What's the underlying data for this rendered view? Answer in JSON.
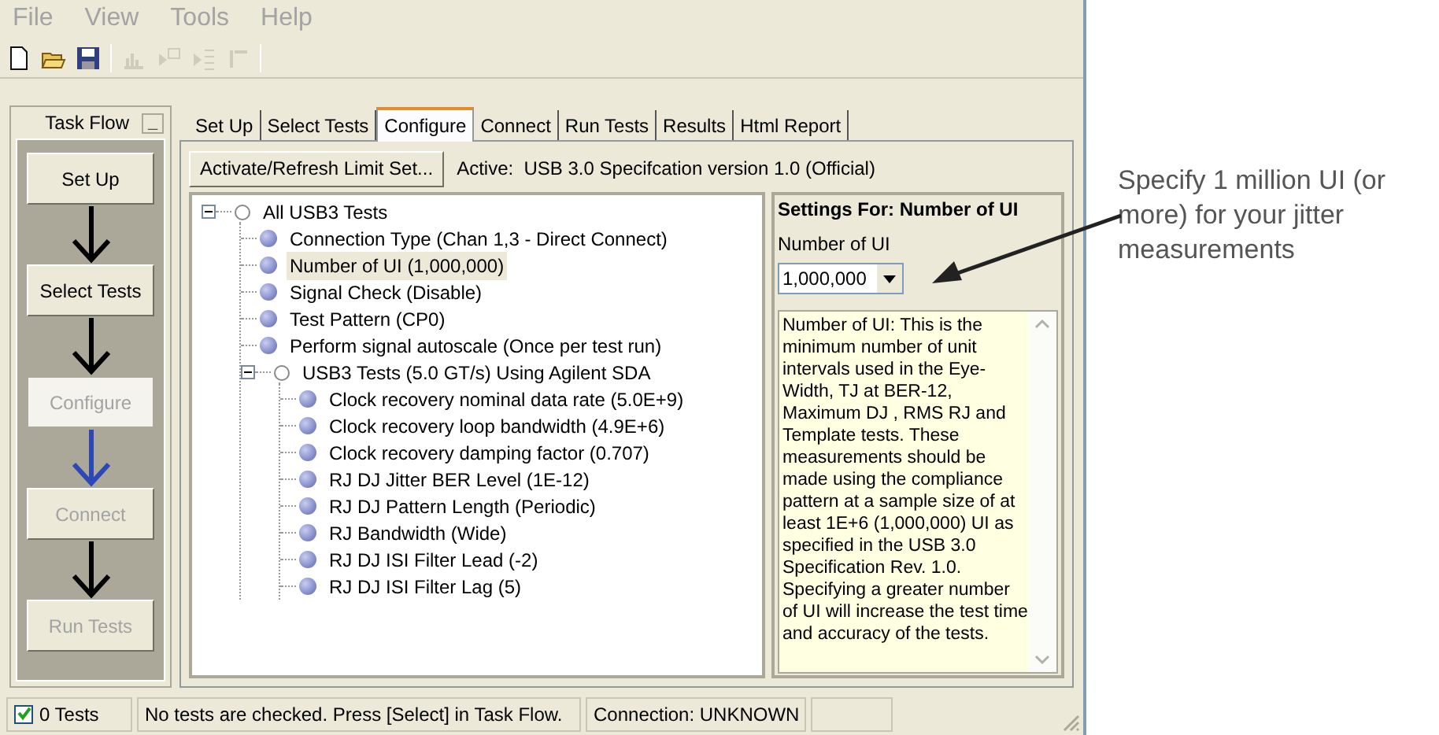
{
  "menu": [
    "File",
    "View",
    "Tools",
    "Help"
  ],
  "toolbar": [
    {
      "kind": "new",
      "disabled": false
    },
    {
      "kind": "open",
      "disabled": false
    },
    {
      "kind": "save",
      "disabled": false
    },
    {
      "kind": "sep"
    },
    {
      "kind": "chart",
      "disabled": true
    },
    {
      "kind": "run",
      "disabled": true
    },
    {
      "kind": "list",
      "disabled": true
    },
    {
      "kind": "bar",
      "disabled": true
    },
    {
      "kind": "sep"
    }
  ],
  "task_flow": {
    "title": "Task Flow",
    "collapse": "_",
    "steps": [
      {
        "label": "Set Up",
        "disabled": false,
        "current": false
      },
      {
        "label": "Select Tests",
        "disabled": false,
        "current": false
      },
      {
        "label": "Configure",
        "disabled": true,
        "current": true
      },
      {
        "label": "Connect",
        "disabled": true,
        "current": false
      },
      {
        "label": "Run Tests",
        "disabled": true,
        "current": false
      }
    ],
    "arrows": [
      {
        "color": "#000000"
      },
      {
        "color": "#000000"
      },
      {
        "color": "#2b47b8"
      },
      {
        "color": "#000000"
      }
    ]
  },
  "tabs": [
    {
      "label": "Set Up",
      "selected": false
    },
    {
      "label": "Select Tests",
      "selected": false
    },
    {
      "label": "Configure",
      "selected": true
    },
    {
      "label": "Connect",
      "selected": false
    },
    {
      "label": "Run Tests",
      "selected": false
    },
    {
      "label": "Results",
      "selected": false
    },
    {
      "label": "Html Report",
      "selected": false
    }
  ],
  "limit_button": "Activate/Refresh Limit Set...",
  "active_text": "Active:  USB 3.0 Specifcation version 1.0 (Official)",
  "tree": [
    {
      "kind": "group",
      "label": "All USB3 Tests",
      "expanded": true,
      "selected": false,
      "children": [
        {
          "kind": "leaf",
          "label": "Connection Type (Chan 1,3 - Direct Connect)",
          "selected": false
        },
        {
          "kind": "leaf",
          "label": "Number of UI (1,000,000)",
          "selected": true
        },
        {
          "kind": "leaf",
          "label": "Signal Check (Disable)",
          "selected": false
        },
        {
          "kind": "leaf",
          "label": "Test Pattern (CP0)",
          "selected": false
        },
        {
          "kind": "leaf",
          "label": "Perform signal autoscale (Once per test run)",
          "selected": false
        },
        {
          "kind": "group",
          "label": "USB3 Tests (5.0 GT/s) Using Agilent SDA",
          "expanded": true,
          "selected": false,
          "children": [
            {
              "kind": "leaf",
              "label": "Clock recovery nominal data rate (5.0E+9)",
              "selected": false
            },
            {
              "kind": "leaf",
              "label": "Clock recovery loop bandwidth (4.9E+6)",
              "selected": false
            },
            {
              "kind": "leaf",
              "label": "Clock recovery damping factor (0.707)",
              "selected": false
            },
            {
              "kind": "leaf",
              "label": "RJ DJ Jitter BER Level (1E-12)",
              "selected": false
            },
            {
              "kind": "leaf",
              "label": "RJ DJ Pattern Length (Periodic)",
              "selected": false
            },
            {
              "kind": "leaf",
              "label": "RJ Bandwidth (Wide)",
              "selected": false
            },
            {
              "kind": "leaf",
              "label": "RJ DJ ISI Filter Lead (-2)",
              "selected": false
            },
            {
              "kind": "leaf",
              "label": "RJ DJ ISI Filter Lag (5)",
              "selected": false
            }
          ]
        }
      ]
    }
  ],
  "settings": {
    "title": "Settings For: Number of UI",
    "field_label": "Number of UI",
    "value": "1,000,000",
    "description": "Number of UI: This is the minimum number of unit intervals used in the Eye-Width, TJ at BER-12, Maximum DJ , RMS RJ  and Template tests. These measurements should be made using the compliance pattern at a sample size of at least 1E+6 (1,000,000) UI as specified in the USB 3.0 Specification Rev. 1.0. Specifying a greater number of UI will increase the test time and accuracy of the tests."
  },
  "status_bar": {
    "tests": {
      "label": "0 Tests",
      "checked": true
    },
    "message": "No tests are checked. Press [Select] in Task Flow.",
    "connection": "Connection: UNKNOWN"
  },
  "annotation": "Specify 1 million UI (or more) for your jitter measurements"
}
